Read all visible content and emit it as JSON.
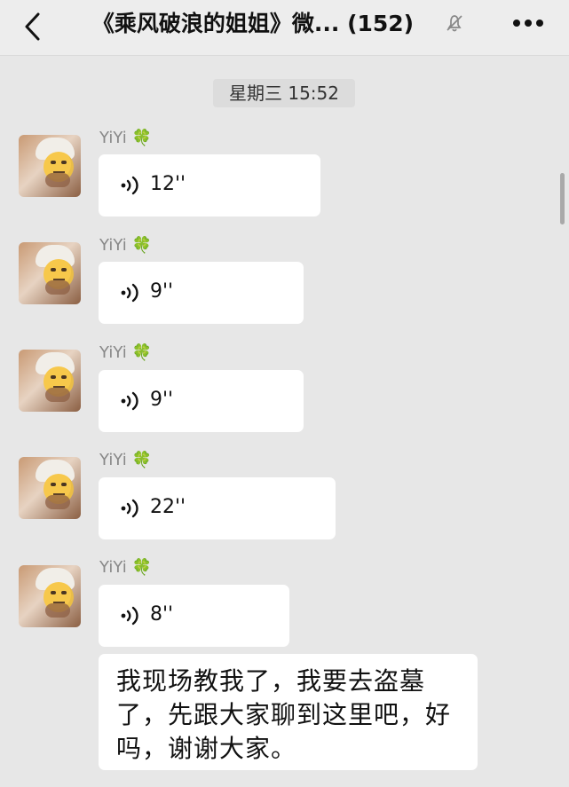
{
  "header": {
    "title": "《乘风破浪的姐姐》微... (152)",
    "back_icon": "back-chevron-icon",
    "mute_icon": "muted-bell-icon",
    "more_icon": "more-dots-icon"
  },
  "timestamp": "星期三 15:52",
  "messages": [
    {
      "sender": "YiYi",
      "sender_badge": "🍀",
      "type": "voice",
      "duration": "12''"
    },
    {
      "sender": "YiYi",
      "sender_badge": "🍀",
      "type": "voice",
      "duration": "9''"
    },
    {
      "sender": "YiYi",
      "sender_badge": "🍀",
      "type": "voice",
      "duration": "9''"
    },
    {
      "sender": "YiYi",
      "sender_badge": "🍀",
      "type": "voice",
      "duration": "22''"
    },
    {
      "sender": "YiYi",
      "sender_badge": "🍀",
      "type": "voice",
      "duration": "8''"
    },
    {
      "sender": "YiYi",
      "type": "text",
      "text": "我现场教我了，我要去盗墓了，先跟大家聊到这里吧，好吗，谢谢大家。"
    }
  ],
  "colors": {
    "chat_background": "#e7e7e7",
    "header_background": "#ededed",
    "bubble_background": "#ffffff",
    "name_color": "#888888",
    "accent_clover": "#53b04f"
  }
}
